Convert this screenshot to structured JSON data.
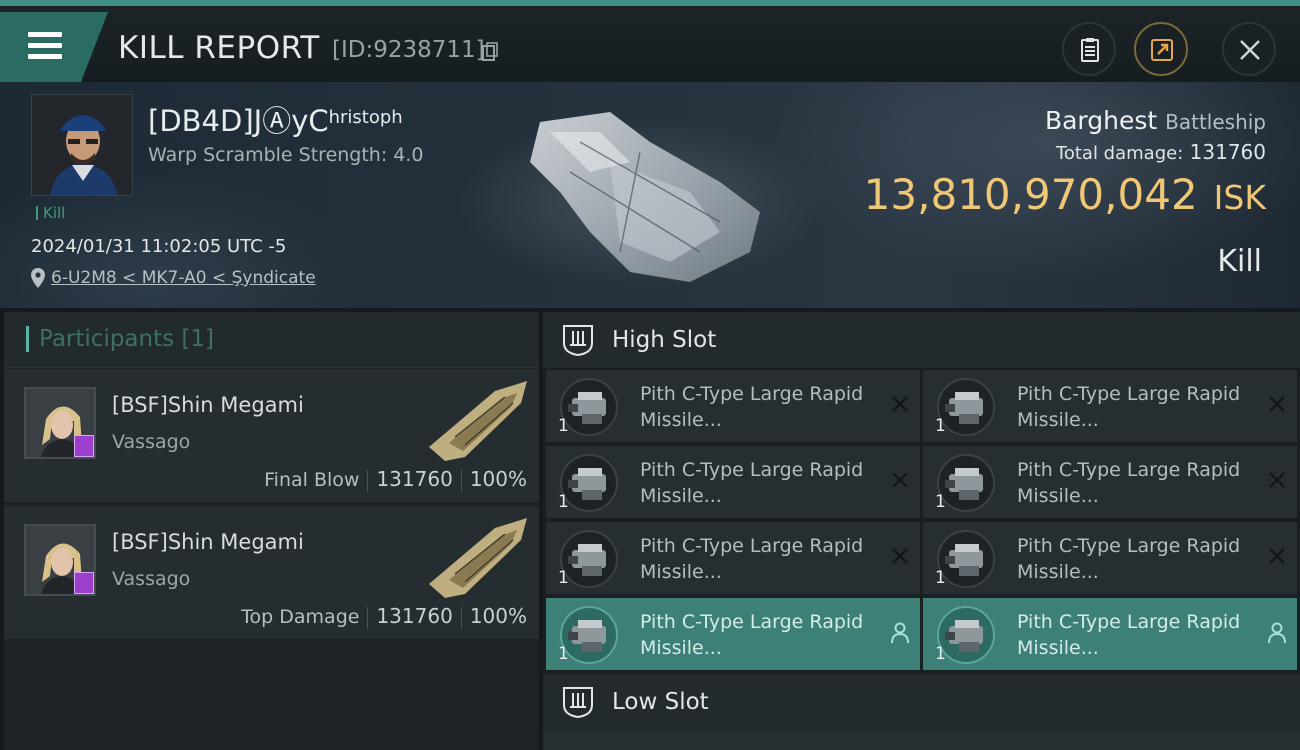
{
  "header": {
    "title": "KILL REPORT",
    "report_id": "[ID:9238711]",
    "icons": [
      "menu-icon",
      "copy-icon",
      "clipboard-icon",
      "share-icon",
      "close-icon"
    ]
  },
  "victim": {
    "name": "[DB4D]JⒶyC",
    "name_suffix": "hristoph",
    "warp_scramble": "Warp Scramble Strength: 4.0",
    "tag": "Kill",
    "datetime": "2024/01/31 11:02:05 UTC -5",
    "location": "6-U2M8 < MK7-A0 < Şyndicate",
    "ship_name": "Barghest",
    "ship_class": "Battleship",
    "total_damage_label": "Total damage:",
    "total_damage": "131760",
    "isk_value": "13,810,970,042",
    "isk_unit": "ISK",
    "result": "Kill"
  },
  "participants": {
    "title": "Participants",
    "count": "[1]",
    "rows": [
      {
        "name": "[BSF]Shin Megami",
        "ship": "Vassago",
        "role": "Final Blow",
        "damage": "131760",
        "percent": "100%"
      },
      {
        "name": "[BSF]Shin Megami",
        "ship": "Vassago",
        "role": "Top Damage",
        "damage": "131760",
        "percent": "100%"
      }
    ]
  },
  "slots": {
    "high_slot_title": "High Slot",
    "low_slot_title": "Low Slot",
    "modules": [
      {
        "name": "Pith C-Type Large Rapid Missile...",
        "qty": "1",
        "status": "destroyed"
      },
      {
        "name": "Pith C-Type Large Rapid Missile...",
        "qty": "1",
        "status": "destroyed"
      },
      {
        "name": "Pith C-Type Large Rapid Missile...",
        "qty": "1",
        "status": "destroyed"
      },
      {
        "name": "Pith C-Type Large Rapid Missile...",
        "qty": "1",
        "status": "destroyed"
      },
      {
        "name": "Pith C-Type Large Rapid Missile...",
        "qty": "1",
        "status": "destroyed"
      },
      {
        "name": "Pith C-Type Large Rapid Missile...",
        "qty": "1",
        "status": "destroyed"
      },
      {
        "name": "Pith C-Type Large Rapid Missile...",
        "qty": "1",
        "status": "dropped"
      },
      {
        "name": "Pith C-Type Large Rapid Missile...",
        "qty": "1",
        "status": "dropped"
      }
    ]
  },
  "colors": {
    "accent": "#3f8f86",
    "isk": "#f0c775",
    "active_module": "#3d8078",
    "pilot_badge": "#9c3fcc"
  }
}
